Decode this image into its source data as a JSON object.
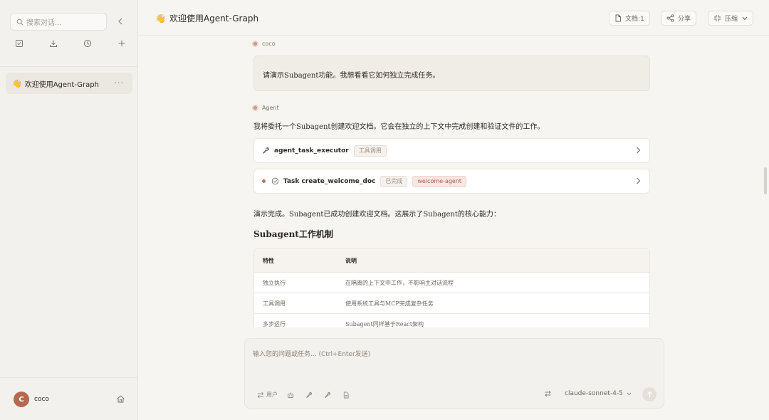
{
  "sidebar": {
    "search_placeholder": "搜索对话...",
    "conversations": [
      {
        "emoji": "👋",
        "title": "欢迎使用Agent-Graph"
      }
    ],
    "more": "···",
    "user": {
      "initial": "C",
      "name": "coco"
    }
  },
  "header": {
    "emoji": "👋",
    "title": "欢迎使用Agent-Graph",
    "docs_button": "文档:1",
    "share_button": "分享",
    "compress_button": "压缩"
  },
  "chat": {
    "user_sender": "coco",
    "user_message": "请演示Subagent功能。我想看看它如何独立完成任务。",
    "agent_sender": "Agent",
    "agent_intro": "我将委托一个Subagent创建欢迎文档。它会在独立的上下文中完成创建和验证文件的工作。",
    "tool_call": {
      "name": "agent_task_executor",
      "tag": "工具调用"
    },
    "task": {
      "name": "Task create_welcome_doc",
      "status": "已完成",
      "agent": "welcome-agent"
    },
    "summary": "演示完成。Subagent已成功创建欢迎文档。这展示了Subagent的核心能力：",
    "section_title": "Subagent工作机制",
    "table": {
      "headers": [
        "特性",
        "说明"
      ],
      "rows": [
        [
          "独立执行",
          "在隔离的上下文中工作，不影响主对话流程"
        ],
        [
          "工具调用",
          "使用系统工具与MCP完成复杂任务"
        ],
        [
          "多步运行",
          "Subagent同样基于React架构"
        ]
      ]
    }
  },
  "composer": {
    "placeholder": "输入您的问题或任务... (Ctrl+Enter发送)",
    "mode_label": "用户",
    "model": "claude-sonnet-4-5"
  },
  "colors": {
    "accent": "#b5694f",
    "tag_red": "#b65a4a",
    "background": "#f7f5f1"
  }
}
